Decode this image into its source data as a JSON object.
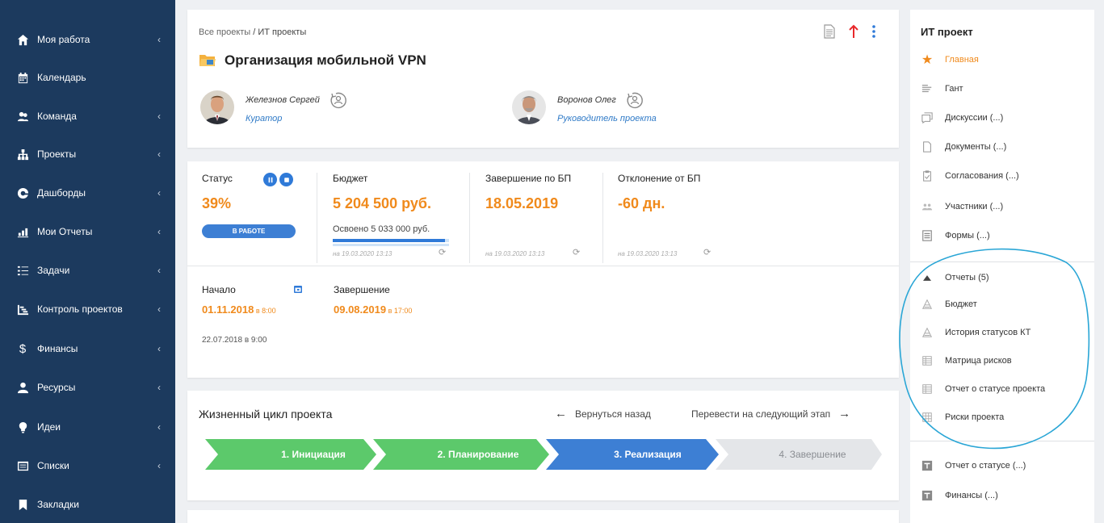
{
  "sidebar": {
    "items": [
      {
        "label": "Моя работа",
        "icon": "home-icon",
        "chevron": "‹"
      },
      {
        "label": "Календарь",
        "icon": "calendar-icon",
        "chevron": ""
      },
      {
        "label": "Команда",
        "icon": "team-icon",
        "chevron": "‹"
      },
      {
        "label": "Проекты",
        "icon": "hierarchy-icon",
        "chevron": "‹"
      },
      {
        "label": "Дашборды",
        "icon": "dashboard-icon",
        "chevron": "‹"
      },
      {
        "label": "Мои Отчеты",
        "icon": "reports-icon",
        "chevron": "‹"
      },
      {
        "label": "Задачи",
        "icon": "tasks-icon",
        "chevron": "‹"
      },
      {
        "label": "Контроль проектов",
        "icon": "project-control-icon",
        "chevron": "‹"
      },
      {
        "label": "Финансы",
        "icon": "dollar-icon",
        "chevron": "‹"
      },
      {
        "label": "Ресурсы",
        "icon": "person-icon",
        "chevron": "‹"
      },
      {
        "label": "Идеи",
        "icon": "lightbulb-icon",
        "chevron": "‹"
      },
      {
        "label": "Списки",
        "icon": "list-icon",
        "chevron": "‹"
      },
      {
        "label": "Закладки",
        "icon": "bookmark-icon",
        "chevron": ""
      }
    ]
  },
  "header": {
    "breadcrumb_root": "Все проекты",
    "breadcrumb_sep": " / ",
    "breadcrumb_current": "ИТ проекты",
    "title": "Организация мобильной VPN",
    "persons": [
      {
        "name": "Железнов Сергей",
        "role": "Куратор"
      },
      {
        "name": "Воронов Олег",
        "role": "Руководитель проекта"
      }
    ]
  },
  "status": {
    "status_title": "Статус",
    "status_value": "39%",
    "status_badge": "В РАБОТЕ",
    "budget_title": "Бюджет",
    "budget_value": "5 204 500 руб.",
    "budget_spent": "Освоено  5 033 000 руб.",
    "budget_progress": 0.967,
    "finish_title": "Завершение по БП",
    "finish_value": "18.05.2019",
    "deviation_title": "Отклонение от БП",
    "deviation_value": "-60 дн.",
    "timestamp": "на 19.03.2020 13:13",
    "refresh_icon": "⟳"
  },
  "dates": {
    "start_title": "Начало",
    "start_date": "01.11.2018",
    "start_time": " в 8:00",
    "end_title": "Завершение",
    "end_date": "09.08.2019",
    "end_time": " в 17:00",
    "plan_date": "22.07.2018 в 9:00"
  },
  "lifecycle": {
    "title": "Жизненный цикл проекта",
    "back_label": "Вернуться назад",
    "next_label": "Перевести на следующий этап",
    "stages": [
      {
        "label": "1. Инициация",
        "state": "done",
        "color": "#5cc96b"
      },
      {
        "label": "2. Планирование",
        "state": "done",
        "color": "#5cc96b"
      },
      {
        "label": "3. Реализация",
        "state": "current",
        "color": "#3d7fd4"
      },
      {
        "label": "4. Завершение",
        "state": "pending",
        "color": "#e4e6e9"
      }
    ]
  },
  "right_panel": {
    "title": "ИТ проект",
    "items": [
      {
        "label": "Главная",
        "icon": "star-icon",
        "active": true
      },
      {
        "label": "Гант",
        "icon": "gantt-icon"
      },
      {
        "label": "Дискуссии (...)",
        "icon": "discussion-icon"
      },
      {
        "label": "Документы (...)",
        "icon": "document-icon"
      },
      {
        "label": "Согласования (...)",
        "icon": "approval-icon"
      },
      {
        "label": "Участники (...)",
        "icon": "participants-icon"
      },
      {
        "label": "Формы (...)",
        "icon": "forms-icon"
      }
    ],
    "reports_header": "Отчеты (5)",
    "reports": [
      {
        "label": "Бюджет",
        "icon": "report-icon"
      },
      {
        "label": "История статусов КТ",
        "icon": "report-icon"
      },
      {
        "label": "Матрица рисков",
        "icon": "table-report-icon"
      },
      {
        "label": "Отчет о статусе проекта",
        "icon": "table-report-icon"
      },
      {
        "label": "Риски проекта",
        "icon": "grid-icon"
      }
    ],
    "extra": [
      {
        "label": "Отчет о статусе (...)",
        "icon": "status-report-icon"
      },
      {
        "label": "Финансы (...)",
        "icon": "finance-report-icon"
      }
    ]
  },
  "colors": {
    "sidebar_bg": "#1c3a5e",
    "accent_orange": "#f08a1c",
    "accent_blue": "#2f7ad8",
    "annotation": "#2aa6d6"
  }
}
